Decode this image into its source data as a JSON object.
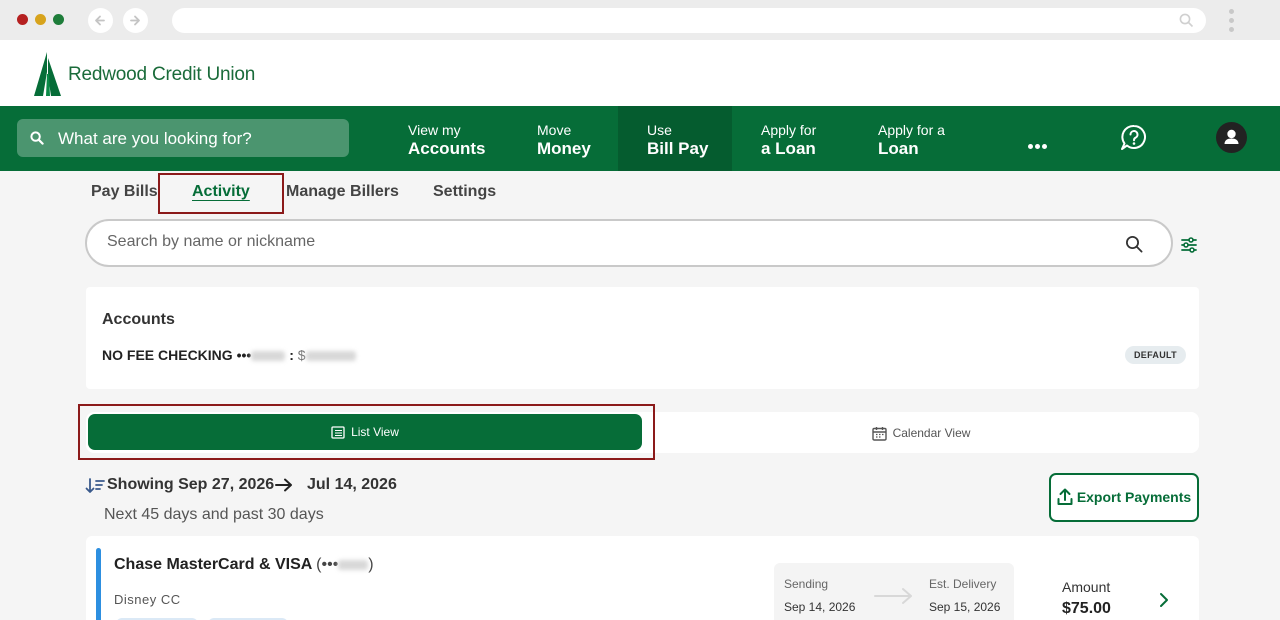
{
  "browser": {
    "back_icon": "arrow-left-icon",
    "forward_icon": "arrow-right-icon",
    "url": ""
  },
  "brand": {
    "name": "Redwood Credit Union",
    "color": "#066d38"
  },
  "nav": {
    "search_placeholder": "What are you looking for?",
    "items": [
      {
        "line1": "View my",
        "line2": "Accounts"
      },
      {
        "line1": "Move",
        "line2": "Money"
      },
      {
        "line1": "Use",
        "line2": "Bill Pay"
      },
      {
        "line1": "Apply for",
        "line2": "a Loan"
      },
      {
        "line1": "Apply for a",
        "line2": "Loan"
      }
    ],
    "active_index": 2
  },
  "subtabs": {
    "items": [
      "Pay Bills",
      "Activity",
      "Manage Billers",
      "Settings"
    ],
    "active": "Activity"
  },
  "search": {
    "placeholder": "Search by name or nickname"
  },
  "accounts": {
    "title": "Accounts",
    "account_name": "NO FEE CHECKING",
    "mask_prefix": "•••",
    "separator": ":",
    "currency": "$",
    "badge": "DEFAULT"
  },
  "view_toggle": {
    "list_label": "List View",
    "calendar_label": "Calendar View",
    "selected": "List View"
  },
  "date_range": {
    "prefix": "Showing",
    "start": "Sep 27, 2026",
    "end": "Jul 14, 2026",
    "subtitle": "Next 45 days and past 30 days"
  },
  "export_label": "Export Payments",
  "payment": {
    "name": "Chase MasterCard & VISA",
    "mask": "(•••",
    "mask_close": ")",
    "nickname": "Disney CC",
    "sending_label": "Sending",
    "sending_date": "Sep 14, 2026",
    "delivery_label": "Est. Delivery",
    "delivery_date": "Sep 15, 2026",
    "amount_label": "Amount",
    "amount": "$75.00"
  }
}
